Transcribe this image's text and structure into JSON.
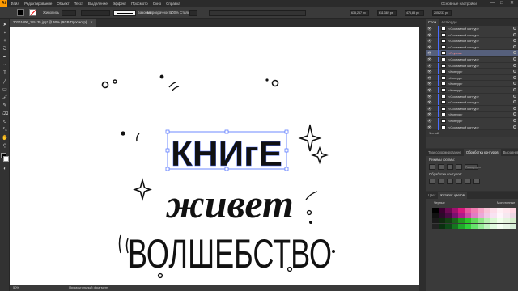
{
  "menubar": {
    "logo": "Ai",
    "items": [
      "Файл",
      "Редактирование",
      "Объект",
      "Текст",
      "Выделение",
      "Эффект",
      "Просмотр",
      "Окно",
      "Справка"
    ],
    "workspace": "Основные настройки",
    "controls": [
      "—",
      "□",
      "✕"
    ]
  },
  "controlbar": {
    "object_label": "Живопись",
    "stroke_label": "Обводка:",
    "stroke_style": "Базовый",
    "opacity_label": "Непрозрачность:",
    "opacity_value": "100%",
    "style_label": "Стиль:",
    "x_value": "635,267 px",
    "y_value": "611,382 px",
    "w_value": "476,88 px",
    "h_value": "205,237 px"
  },
  "document": {
    "tab_label": "20201006_115135.jpg* @ 50% (RGB/Просмотр)",
    "zoom": "50%",
    "status": "Прямоугольный фрагмент"
  },
  "artwork": {
    "line1": "КНИгЕ",
    "line2": "живет",
    "line3": "ВОЛШЕБСТВО"
  },
  "layers_panel": {
    "tabs": [
      "Слои",
      "Артборды"
    ],
    "rows": [
      {
        "name": "<Составной контур>",
        "highlighted": false
      },
      {
        "name": "<Составной контур>",
        "highlighted": false
      },
      {
        "name": "<Составной контур>",
        "highlighted": false
      },
      {
        "name": "<Составной контур>",
        "highlighted": false
      },
      {
        "name": "<Группа>",
        "highlighted": true
      },
      {
        "name": "<Составной контур>",
        "highlighted": false
      },
      {
        "name": "<Составной контур>",
        "highlighted": false
      },
      {
        "name": "<Контур>",
        "highlighted": false
      },
      {
        "name": "<Контур>",
        "highlighted": false
      },
      {
        "name": "<Контур>",
        "highlighted": false
      },
      {
        "name": "<Контур>",
        "highlighted": false
      },
      {
        "name": "<Составной контур>",
        "highlighted": false
      },
      {
        "name": "<Составной контур>",
        "highlighted": false
      },
      {
        "name": "<Составной контур>",
        "highlighted": false
      },
      {
        "name": "<Контур>",
        "highlighted": false
      },
      {
        "name": "<Контур>",
        "highlighted": false
      },
      {
        "name": "<Составной контур>",
        "highlighted": false
      }
    ],
    "footer": "1 слой"
  },
  "pathfinder_panel": {
    "tabs": [
      "Трансформирование",
      "Обработка контуров",
      "Выравнивание"
    ],
    "shape_modes_label": "Режимы формы:",
    "pathfinders_label": "Обработка контуров:",
    "apply_label": "Развернуть"
  },
  "swatches_panel": {
    "tabs": [
      "Цвет",
      "Каталог цветов"
    ],
    "col_headers": [
      "Черные",
      "Монотонные"
    ],
    "colors": [
      "#000000",
      "#3b0030",
      "#6b0a52",
      "#a0106e",
      "#d8197e",
      "#e85aa0",
      "#f07db2",
      "#f5a3c6",
      "#f9c4d8",
      "#fcdce8",
      "#fff0f5",
      "#ffe6ee",
      "#ffd6e2",
      "#111111",
      "#2c0a2a",
      "#4a0a44",
      "#7a1070",
      "#b01a8a",
      "#d04aa8",
      "#e07cc4",
      "#eba8d8",
      "#f2c8e6",
      "#f8e2f2",
      "#fff5fb",
      "#f6e8f0",
      "#ecd6e2",
      "#1a1a1a",
      "#0f2a0f",
      "#144014",
      "#1a661a",
      "#22991e",
      "#2ec428",
      "#5fd858",
      "#8ee686",
      "#b8f0b0",
      "#d8f8d2",
      "#efffea",
      "#e4f4de",
      "#d4ecca",
      "#222222",
      "#0a3010",
      "#0e4a18",
      "#167420",
      "#1fa82a",
      "#30d03a",
      "#66e26c",
      "#96ec98",
      "#c0f4c0",
      "#e0fae0",
      "#f4fff4",
      "#e8f6e8",
      "#d8eed8"
    ]
  }
}
